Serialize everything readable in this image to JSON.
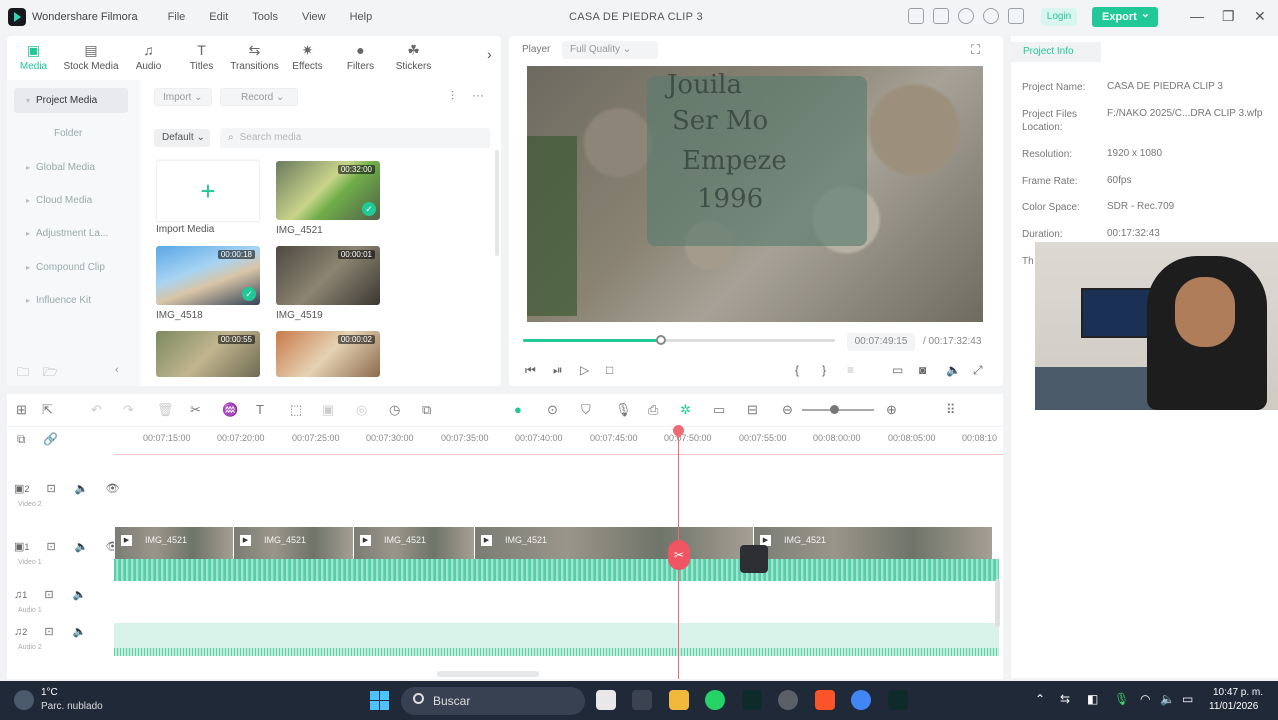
{
  "app": {
    "name": "Wondershare Filmora",
    "window_title": "CASA DE PIEDRA CLIP 3",
    "login_label": "Login",
    "export_label": "Export"
  },
  "menu": [
    "File",
    "Edit",
    "Tools",
    "View",
    "Help"
  ],
  "media_tabs": [
    {
      "label": "Media",
      "icon": "media-icon"
    },
    {
      "label": "Stock Media",
      "icon": "stock-media-icon"
    },
    {
      "label": "Audio",
      "icon": "music-note-icon"
    },
    {
      "label": "Titles",
      "icon": "titles-icon"
    },
    {
      "label": "Transitions",
      "icon": "transitions-icon"
    },
    {
      "label": "Effects",
      "icon": "effects-icon"
    },
    {
      "label": "Filters",
      "icon": "filters-icon"
    },
    {
      "label": "Stickers",
      "icon": "stickers-icon"
    }
  ],
  "media_sidebar": [
    "Project Media",
    "Folder",
    "Global Media",
    "Cloud Media",
    "Adjustment La...",
    "Compound Clip",
    "Influence Kit"
  ],
  "media_toolbar": {
    "import": "Import",
    "record": "Record",
    "sort": "Default",
    "search_placeholder": "Search media"
  },
  "media_items": [
    {
      "label": "Import Media"
    },
    {
      "label": "IMG_4521",
      "duration": "00:32:00",
      "checked": true
    },
    {
      "label": "IMG_4518",
      "duration": "00:00:18",
      "checked": true
    },
    {
      "label": "IMG_4519",
      "duration": "00:00:01",
      "checked": false
    },
    {
      "label": "",
      "duration": "00:00:55",
      "checked": true
    },
    {
      "label": "",
      "duration": "00:00:02",
      "checked": false
    }
  ],
  "player": {
    "label": "Player",
    "quality": "Full Quality",
    "current_time": "00:07:49:15",
    "total_time": "/ 00:17:32:43",
    "progress": 0.442
  },
  "project_info": {
    "tab": "Project Info",
    "fields": [
      {
        "key": "Project Name:",
        "value": "CASA DE PIEDRA CLIP 3"
      },
      {
        "key": "Project Files Location:",
        "value": "F:/NAKO 2025/C...DRA CLIP 3.wfp"
      },
      {
        "key": "Resolution:",
        "value": "1920 x 1080"
      },
      {
        "key": "Frame Rate:",
        "value": "60fps"
      },
      {
        "key": "Color Space:",
        "value": "SDR - Rec.709"
      },
      {
        "key": "Duration:",
        "value": "00:17:32:43"
      },
      {
        "key": "Th",
        "value": ""
      }
    ]
  },
  "ruler_ticks": [
    "00:07:15:00",
    "00:07:20:00",
    "00:07:25:00",
    "00:07:30:00",
    "00:07:35:00",
    "00:07:40:00",
    "00:07:45:00",
    "00:07:50:00",
    "00:07:55:00",
    "00:08:00:00",
    "00:08:05:00",
    "00:08:10"
  ],
  "tracks": {
    "video2": "Video 2",
    "video1": "Video 1",
    "audio1": "Audio 1",
    "audio2": "Audio 2",
    "v2_num": "2",
    "v1_num": "1",
    "a1_num": "1",
    "a2_num": "2"
  },
  "clips": [
    "IMG_4521",
    "IMG_4521",
    "IMG_4521",
    "IMG_4521",
    "IMG_4521"
  ],
  "taskbar": {
    "temp": "1°C",
    "weather": "Parc. nublado",
    "search": "Buscar",
    "time": "10:47 p. m.",
    "date": "11/01/2026"
  },
  "video_overlay_text": [
    "Jouila",
    "Ser Mo",
    "Empeze",
    "1996"
  ]
}
